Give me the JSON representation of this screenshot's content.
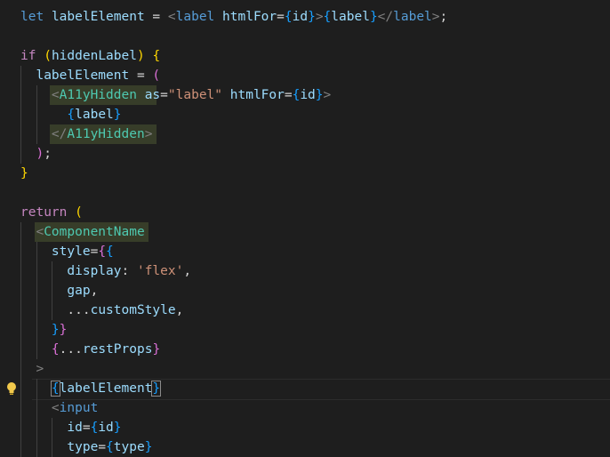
{
  "editor": {
    "language": "tsx",
    "theme_colors": {
      "background": "#1e1e1e",
      "keyword": "#569cd6",
      "control": "#c586c0",
      "variable": "#9cdcfe",
      "component": "#4ec9b0",
      "string": "#ce9178",
      "bracket_gold": "#ffd700",
      "bracket_purple": "#da70d6",
      "bracket_blue": "#179fff"
    },
    "gutter_icon": "lightbulb-icon",
    "lines": [
      [
        [
          "let",
          "kw"
        ],
        [
          " ",
          ""
        ],
        [
          "labelElement",
          "var"
        ],
        [
          " = ",
          "op"
        ],
        [
          "<",
          "tag"
        ],
        [
          "label",
          "kw"
        ],
        [
          " ",
          ""
        ],
        [
          "htmlFor",
          "var"
        ],
        [
          "=",
          "op"
        ],
        [
          "{",
          "bb"
        ],
        [
          "id",
          "var"
        ],
        [
          "}",
          "bb"
        ],
        [
          ">",
          "tag"
        ],
        [
          "{",
          "bb"
        ],
        [
          "label",
          "var"
        ],
        [
          "}",
          "bb"
        ],
        [
          "</",
          "tag"
        ],
        [
          "label",
          "kw"
        ],
        [
          ">",
          "tag"
        ],
        [
          ";",
          "op"
        ]
      ],
      [],
      [
        [
          "if",
          "ctl"
        ],
        [
          " ",
          ""
        ],
        [
          "(",
          "by"
        ],
        [
          "hiddenLabel",
          "var"
        ],
        [
          ")",
          "by"
        ],
        [
          " ",
          ""
        ],
        [
          "{",
          "by"
        ]
      ],
      [
        [
          "  labelElement",
          "var"
        ],
        [
          " = ",
          "op"
        ],
        [
          "(",
          "bp"
        ]
      ],
      [
        [
          "    ",
          ""
        ],
        [
          "<",
          "tag"
        ],
        [
          "A11yHidden",
          "cmp"
        ],
        [
          " ",
          ""
        ],
        [
          "as",
          "var"
        ],
        [
          "=",
          "op"
        ],
        [
          "\"label\"",
          "str"
        ],
        [
          " ",
          ""
        ],
        [
          "htmlFor",
          "var"
        ],
        [
          "=",
          "op"
        ],
        [
          "{",
          "bb"
        ],
        [
          "id",
          "var"
        ],
        [
          "}",
          "bb"
        ],
        [
          ">",
          "tag"
        ]
      ],
      [
        [
          "      ",
          ""
        ],
        [
          "{",
          "bb"
        ],
        [
          "label",
          "var"
        ],
        [
          "}",
          "bb"
        ]
      ],
      [
        [
          "    ",
          ""
        ],
        [
          "</",
          "tag"
        ],
        [
          "A11yHidden",
          "cmp"
        ],
        [
          ">",
          "tag"
        ]
      ],
      [
        [
          "  ",
          ""
        ],
        [
          ")",
          "bp"
        ],
        [
          ";",
          "op"
        ]
      ],
      [
        [
          "}",
          "by"
        ]
      ],
      [],
      [
        [
          "return",
          "ctl"
        ],
        [
          " ",
          ""
        ],
        [
          "(",
          "by"
        ]
      ],
      [
        [
          "  ",
          ""
        ],
        [
          "<",
          "tag"
        ],
        [
          "ComponentName",
          "cmp"
        ]
      ],
      [
        [
          "    ",
          ""
        ],
        [
          "style",
          "var"
        ],
        [
          "=",
          "op"
        ],
        [
          "{",
          "bp"
        ],
        [
          "{",
          "bb"
        ]
      ],
      [
        [
          "      ",
          ""
        ],
        [
          "display",
          "var"
        ],
        [
          ": ",
          "op"
        ],
        [
          "'flex'",
          "str"
        ],
        [
          ",",
          "op"
        ]
      ],
      [
        [
          "      ",
          ""
        ],
        [
          "gap",
          "var"
        ],
        [
          ",",
          "op"
        ]
      ],
      [
        [
          "      ",
          ""
        ],
        [
          "...",
          "op"
        ],
        [
          "customStyle",
          "var"
        ],
        [
          ",",
          "op"
        ]
      ],
      [
        [
          "    ",
          ""
        ],
        [
          "}",
          "bb"
        ],
        [
          "}",
          "bp"
        ]
      ],
      [
        [
          "    ",
          ""
        ],
        [
          "{",
          "bp"
        ],
        [
          "...",
          "op"
        ],
        [
          "restProps",
          "var"
        ],
        [
          "}",
          "bp"
        ]
      ],
      [
        [
          "  ",
          ""
        ],
        [
          ">",
          "tag"
        ]
      ],
      [
        [
          "    ",
          ""
        ],
        [
          "{",
          "bb"
        ],
        [
          "labelElement",
          "var"
        ],
        [
          "}",
          "bb"
        ]
      ],
      [
        [
          "    ",
          ""
        ],
        [
          "<",
          "tag"
        ],
        [
          "input",
          "kw"
        ]
      ],
      [
        [
          "      ",
          ""
        ],
        [
          "id",
          "var"
        ],
        [
          "=",
          "op"
        ],
        [
          "{",
          "bb"
        ],
        [
          "id",
          "var"
        ],
        [
          "}",
          "bb"
        ]
      ],
      [
        [
          "      ",
          ""
        ],
        [
          "type",
          "var"
        ],
        [
          "=",
          "op"
        ],
        [
          "{",
          "bb"
        ],
        [
          "type",
          "var"
        ],
        [
          "}",
          "bb"
        ]
      ]
    ]
  }
}
